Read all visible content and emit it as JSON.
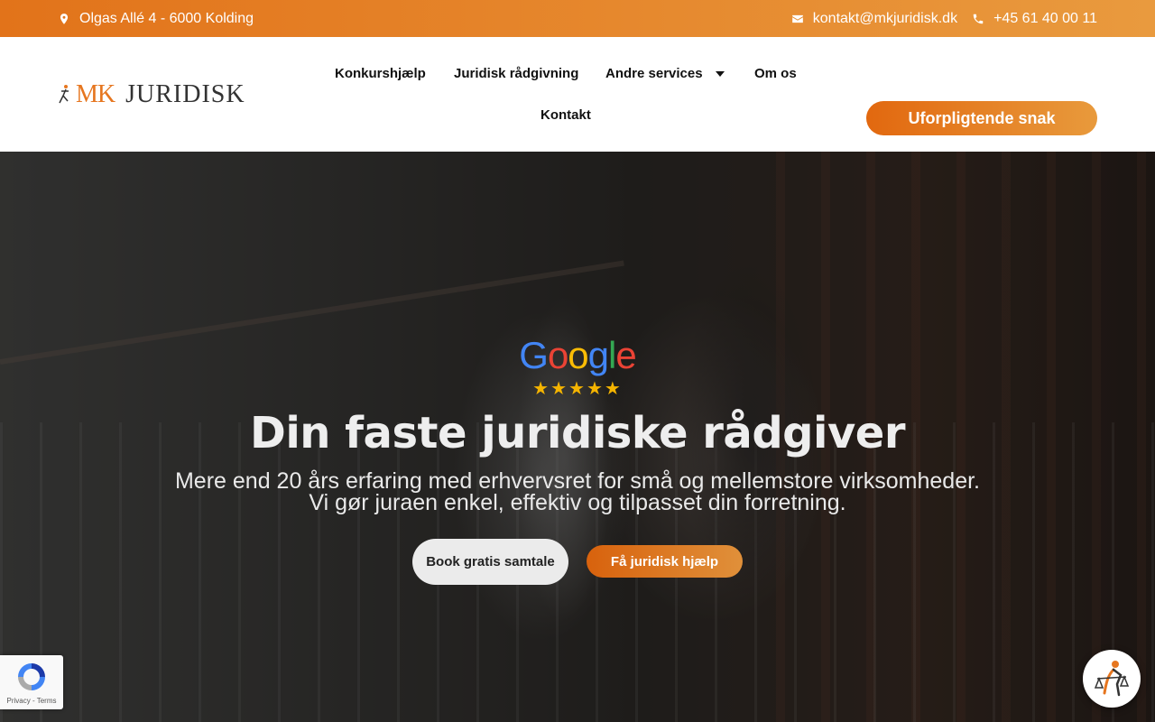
{
  "topbar": {
    "address": "Olgas Allé 4 - 6000 Kolding",
    "email": "kontakt@mkjuridisk.dk",
    "phone": "+45 61 40 00 11",
    "icons": {
      "address": "map-pin-icon",
      "email": "envelope-icon",
      "phone": "phone-icon"
    }
  },
  "header": {
    "logo": {
      "mk": "MK",
      "name": "JURIDISK"
    },
    "nav": [
      {
        "label": "Konkurshjælp"
      },
      {
        "label": "Juridisk rådgivning"
      },
      {
        "label": "Andre services",
        "has_dropdown": true
      },
      {
        "label": "Om os"
      },
      {
        "label": "Kontakt"
      }
    ],
    "cta": "Uforpligtende snak"
  },
  "hero": {
    "rating_brand": "Google",
    "rating_stars": "★★★★★",
    "title": "Din faste juridiske rådgiver",
    "subtitle_line1": "Mere end 20 års erfaring med erhvervsret for små og mellemstore virksomheder.",
    "subtitle_line2": "Vi gør juraen enkel, effektiv og tilpasset din forretning.",
    "btn_book": "Book gratis samtale",
    "btn_help": "Få juridisk hjælp"
  },
  "recaptcha": {
    "terms": "Privacy - Terms"
  },
  "colors": {
    "accent": "#e2731a",
    "accent_light": "#e99a3e",
    "star": "#f5b400",
    "google_blue": "#4285f4",
    "google_red": "#ea4335",
    "google_yellow": "#fbbc05",
    "google_green": "#34a853"
  }
}
